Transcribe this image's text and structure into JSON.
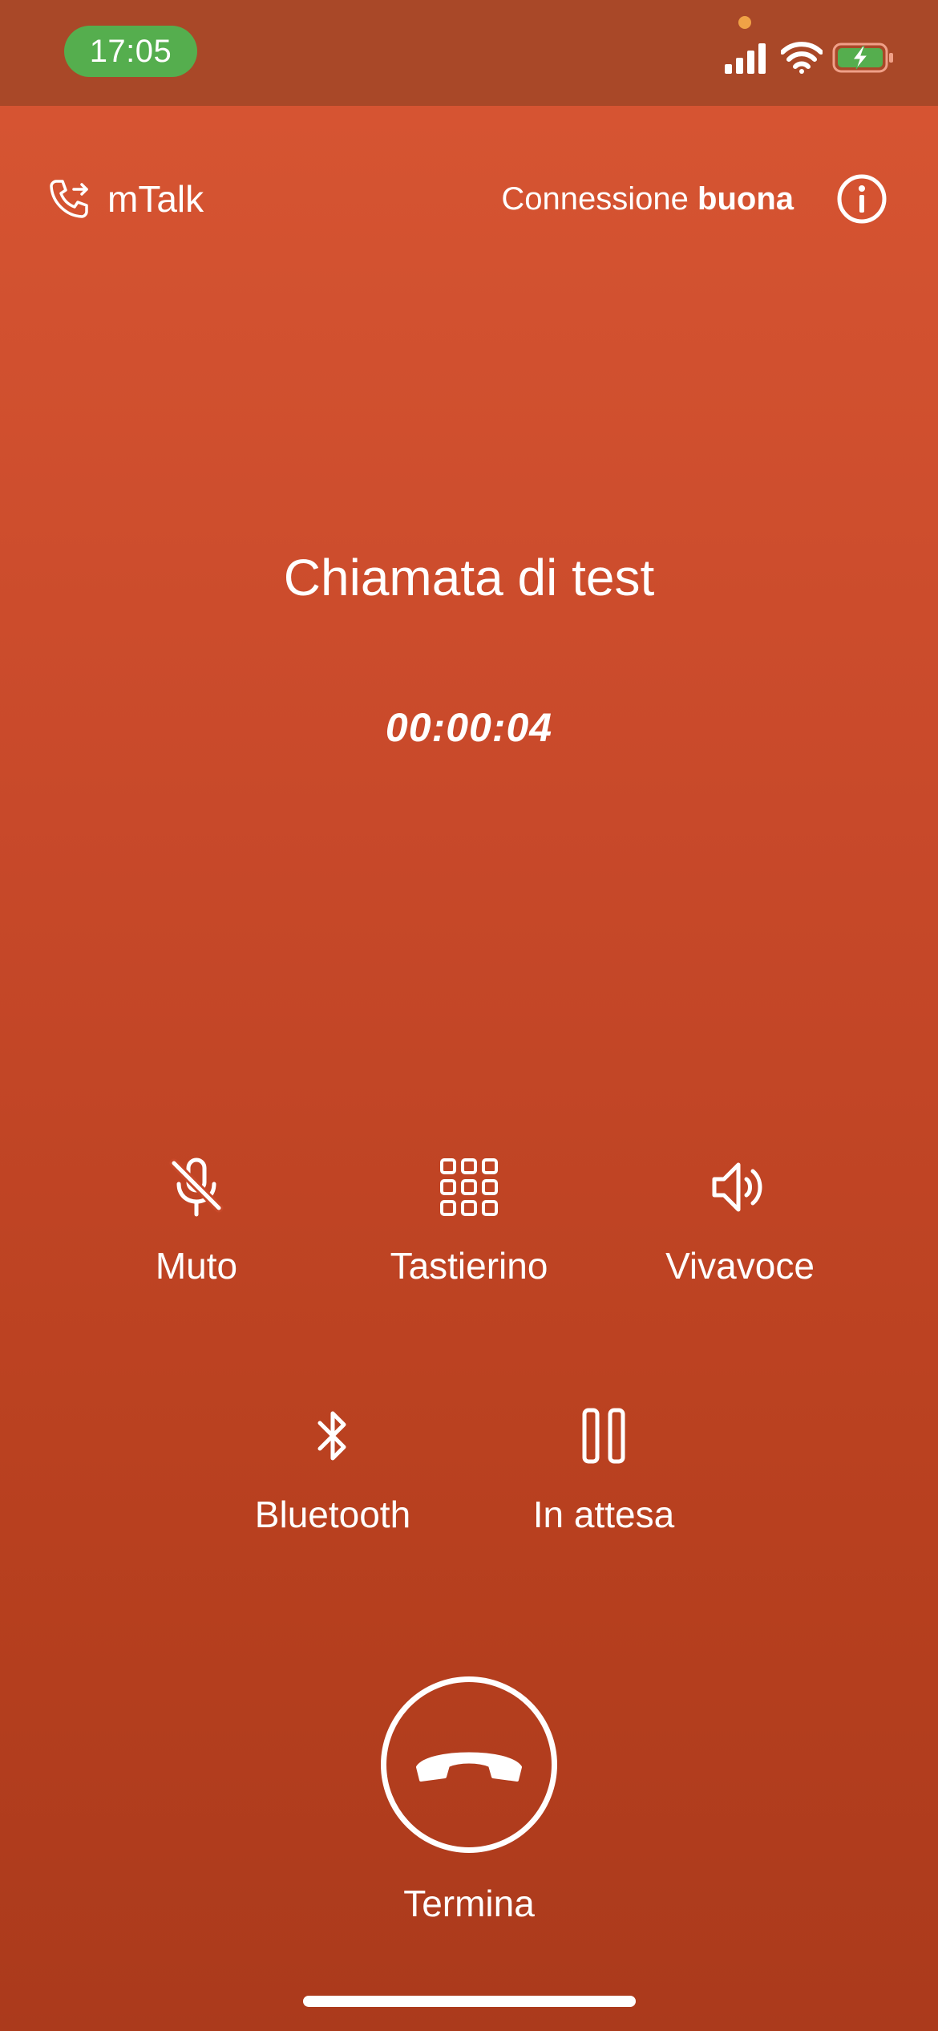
{
  "status_bar": {
    "time": "17:05",
    "time_pill_color": "#55ae4e",
    "privacy_dot_color": "#f0a246",
    "icons": [
      "signal-icon",
      "wifi-icon",
      "battery-charging-icon"
    ]
  },
  "header": {
    "app_icon": "phone-outgoing-icon",
    "app_name": "mTalk",
    "connection_label": "Connessione",
    "connection_quality": "buona",
    "info_icon": "info-icon"
  },
  "call": {
    "title": "Chiamata di test",
    "timer": "00:00:04"
  },
  "controls": [
    {
      "icon": "microphone-off-icon",
      "label": "Muto"
    },
    {
      "icon": "keypad-icon",
      "label": "Tastierino"
    },
    {
      "icon": "speaker-icon",
      "label": "Vivavoce"
    },
    {
      "icon": "bluetooth-icon",
      "label": "Bluetooth"
    },
    {
      "icon": "pause-icon",
      "label": "In attesa"
    }
  ],
  "end_call": {
    "icon": "hang-up-icon",
    "label": "Termina"
  },
  "colors": {
    "background_top": "#d85633",
    "background_bottom": "#ab3a1c",
    "status_bar": "#a94828"
  }
}
